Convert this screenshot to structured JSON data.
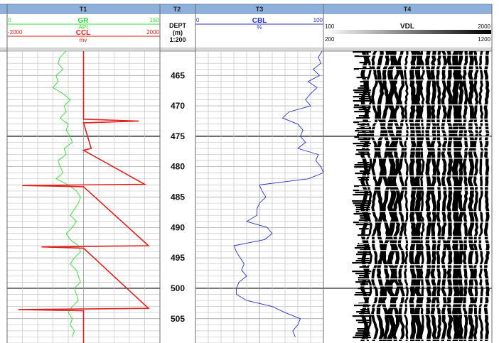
{
  "tracks": {
    "t1": "T1",
    "t2": "T2",
    "t3": "T3",
    "t4": "T4"
  },
  "curves": {
    "gr": {
      "name": "GR",
      "unit": "API",
      "min": "0",
      "max": "150",
      "color": "#33dd33"
    },
    "ccl": {
      "name": "CCL",
      "unit": "mv",
      "min": "-2000",
      "max": "2000",
      "color": "#e0201c"
    },
    "cbl": {
      "name": "CBL",
      "unit": "%",
      "min": "0",
      "max": "100",
      "color": "#2a35c8"
    },
    "vdl": {
      "name": "VDL",
      "min1": "100",
      "max1": "2000",
      "min2": "200",
      "max2": "1200"
    }
  },
  "depth": {
    "label": "DEPT",
    "unit": "(m)",
    "scale": "1:200"
  },
  "chart_data": {
    "type": "line",
    "y_axis": {
      "label": "DEPT",
      "unit": "m",
      "range": [
        461,
        509
      ],
      "ticks": [
        465,
        470,
        475,
        480,
        485,
        490,
        495,
        500,
        505
      ]
    },
    "series": [
      {
        "name": "GR",
        "unit": "API",
        "xlim": [
          0,
          150
        ],
        "depth": [
          461,
          462,
          463,
          464,
          465,
          466,
          467,
          468,
          469,
          470,
          471,
          472,
          473,
          474,
          475,
          476,
          477,
          478,
          479,
          480,
          481,
          482,
          483,
          484,
          485,
          486,
          487,
          488,
          489,
          490,
          491,
          492,
          493,
          494,
          495,
          496,
          497,
          498,
          499,
          500,
          501,
          502,
          503,
          504,
          505,
          506,
          507,
          508
        ],
        "values": [
          58,
          52,
          50,
          55,
          48,
          50,
          45,
          55,
          62,
          56,
          58,
          52,
          60,
          58,
          62,
          64,
          56,
          58,
          50,
          52,
          55,
          48,
          60,
          68,
          72,
          70,
          66,
          62,
          68,
          64,
          58,
          62,
          70,
          72,
          66,
          62,
          68,
          70,
          72,
          66,
          68,
          70,
          64,
          60,
          64,
          62,
          66,
          64
        ]
      },
      {
        "name": "CCL",
        "unit": "mv",
        "xlim": [
          -2000,
          2000
        ],
        "depth": [
          461,
          472.2,
          472.5,
          472.8,
          477.0,
          477.3,
          482.9,
          483.1,
          483.3,
          493.0,
          493.2,
          493.4,
          503.3,
          503.5,
          503.7,
          509
        ],
        "values": [
          0,
          0,
          1450,
          0,
          200,
          0,
          1600,
          -1600,
          0,
          1700,
          -1100,
          0,
          1700,
          -1700,
          0,
          0
        ]
      },
      {
        "name": "CBL",
        "unit": "%",
        "xlim": [
          0,
          100
        ],
        "depth": [
          461,
          462,
          463,
          464,
          465,
          466,
          467,
          468,
          469,
          470,
          471,
          472,
          473,
          474,
          475,
          476,
          477,
          478,
          479,
          480,
          481,
          482,
          483,
          484,
          485,
          486,
          487,
          488,
          489,
          490,
          491,
          492,
          493,
          494,
          495,
          496,
          497,
          498,
          499,
          500,
          501,
          502,
          503,
          504,
          505,
          506,
          507,
          508
        ],
        "values": [
          99,
          96,
          98,
          92,
          97,
          88,
          95,
          90,
          86,
          90,
          73,
          68,
          80,
          84,
          82,
          86,
          80,
          96,
          94,
          98,
          100,
          88,
          50,
          52,
          55,
          50,
          48,
          48,
          40,
          56,
          60,
          54,
          30,
          32,
          35,
          38,
          36,
          40,
          34,
          32,
          32,
          40,
          60,
          70,
          82,
          80,
          76,
          78
        ]
      }
    ]
  }
}
